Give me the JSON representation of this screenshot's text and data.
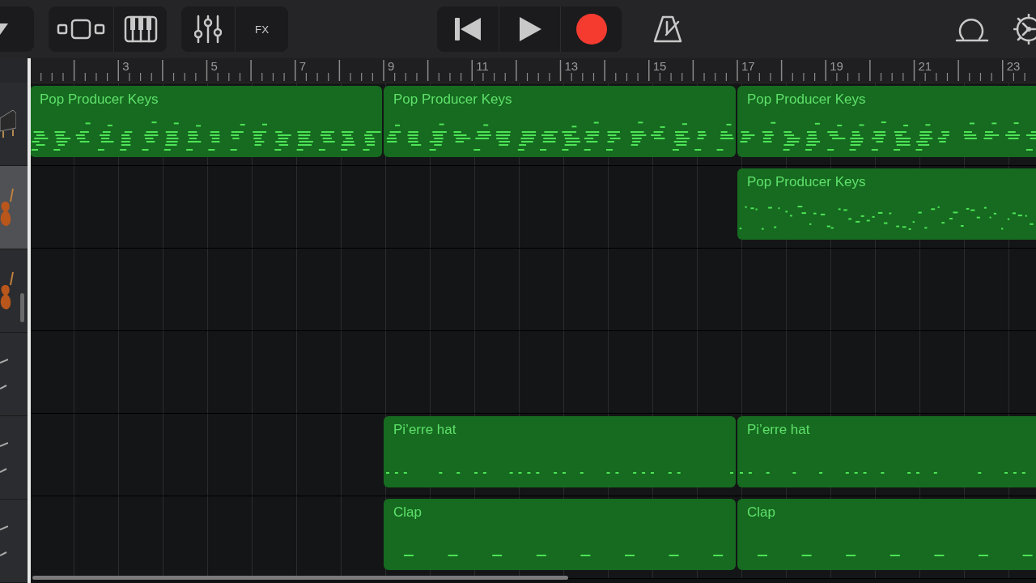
{
  "toolbar": {
    "groups": [
      {
        "kind": "menu",
        "buttons": [
          {
            "kind": "dropdown"
          }
        ]
      },
      {
        "kind": "views",
        "buttons": [
          {
            "kind": "tracks-view"
          },
          {
            "kind": "keyboard"
          }
        ]
      },
      {
        "kind": "mix",
        "buttons": [
          {
            "kind": "mixer"
          },
          {
            "kind": "fx",
            "label": "FX"
          }
        ]
      }
    ],
    "transport": [
      {
        "kind": "rewind"
      },
      {
        "kind": "play"
      },
      {
        "kind": "record"
      }
    ],
    "metronome": {
      "kind": "metronome"
    },
    "right": [
      {
        "kind": "loop"
      },
      {
        "kind": "settings"
      }
    ]
  },
  "ruler": {
    "labels": [
      "3",
      "5",
      "7",
      "9",
      "11",
      "13",
      "15",
      "17",
      "19",
      "21",
      "23"
    ]
  },
  "tracks": [
    {
      "kind": "keys",
      "selected": false,
      "regions": [
        {
          "filled": true,
          "label": "Pop Producer Keys",
          "kind": "keys"
        },
        {
          "filled": true,
          "label": "Pop Producer Keys",
          "kind": "keys"
        },
        {
          "filled": true,
          "label": "Pop Producer Keys",
          "kind": "keys"
        }
      ]
    },
    {
      "kind": "bass",
      "selected": true,
      "regions": [
        {
          "filled": false
        },
        {
          "filled": false
        },
        {
          "filled": true,
          "label": "Pop Producer Keys",
          "kind": "sparse"
        }
      ]
    },
    {
      "kind": "bass",
      "selected": false,
      "regions": [
        {
          "filled": false
        },
        {
          "filled": false
        },
        {
          "filled": false
        }
      ]
    },
    {
      "kind": "drums",
      "selected": false,
      "regions": [
        {
          "filled": false
        },
        {
          "filled": false
        },
        {
          "filled": false
        }
      ]
    },
    {
      "kind": "drums",
      "selected": false,
      "regions": [
        {
          "filled": false
        },
        {
          "filled": true,
          "label": "Pi’erre hat",
          "kind": "hat"
        },
        {
          "filled": true,
          "label": "Pi’erre hat",
          "kind": "hat"
        }
      ]
    },
    {
      "kind": "drums",
      "selected": false,
      "regions": [
        {
          "filled": false
        },
        {
          "filled": true,
          "label": "Clap",
          "kind": "clap"
        },
        {
          "filled": true,
          "label": "Clap",
          "kind": "clap"
        }
      ]
    }
  ]
}
